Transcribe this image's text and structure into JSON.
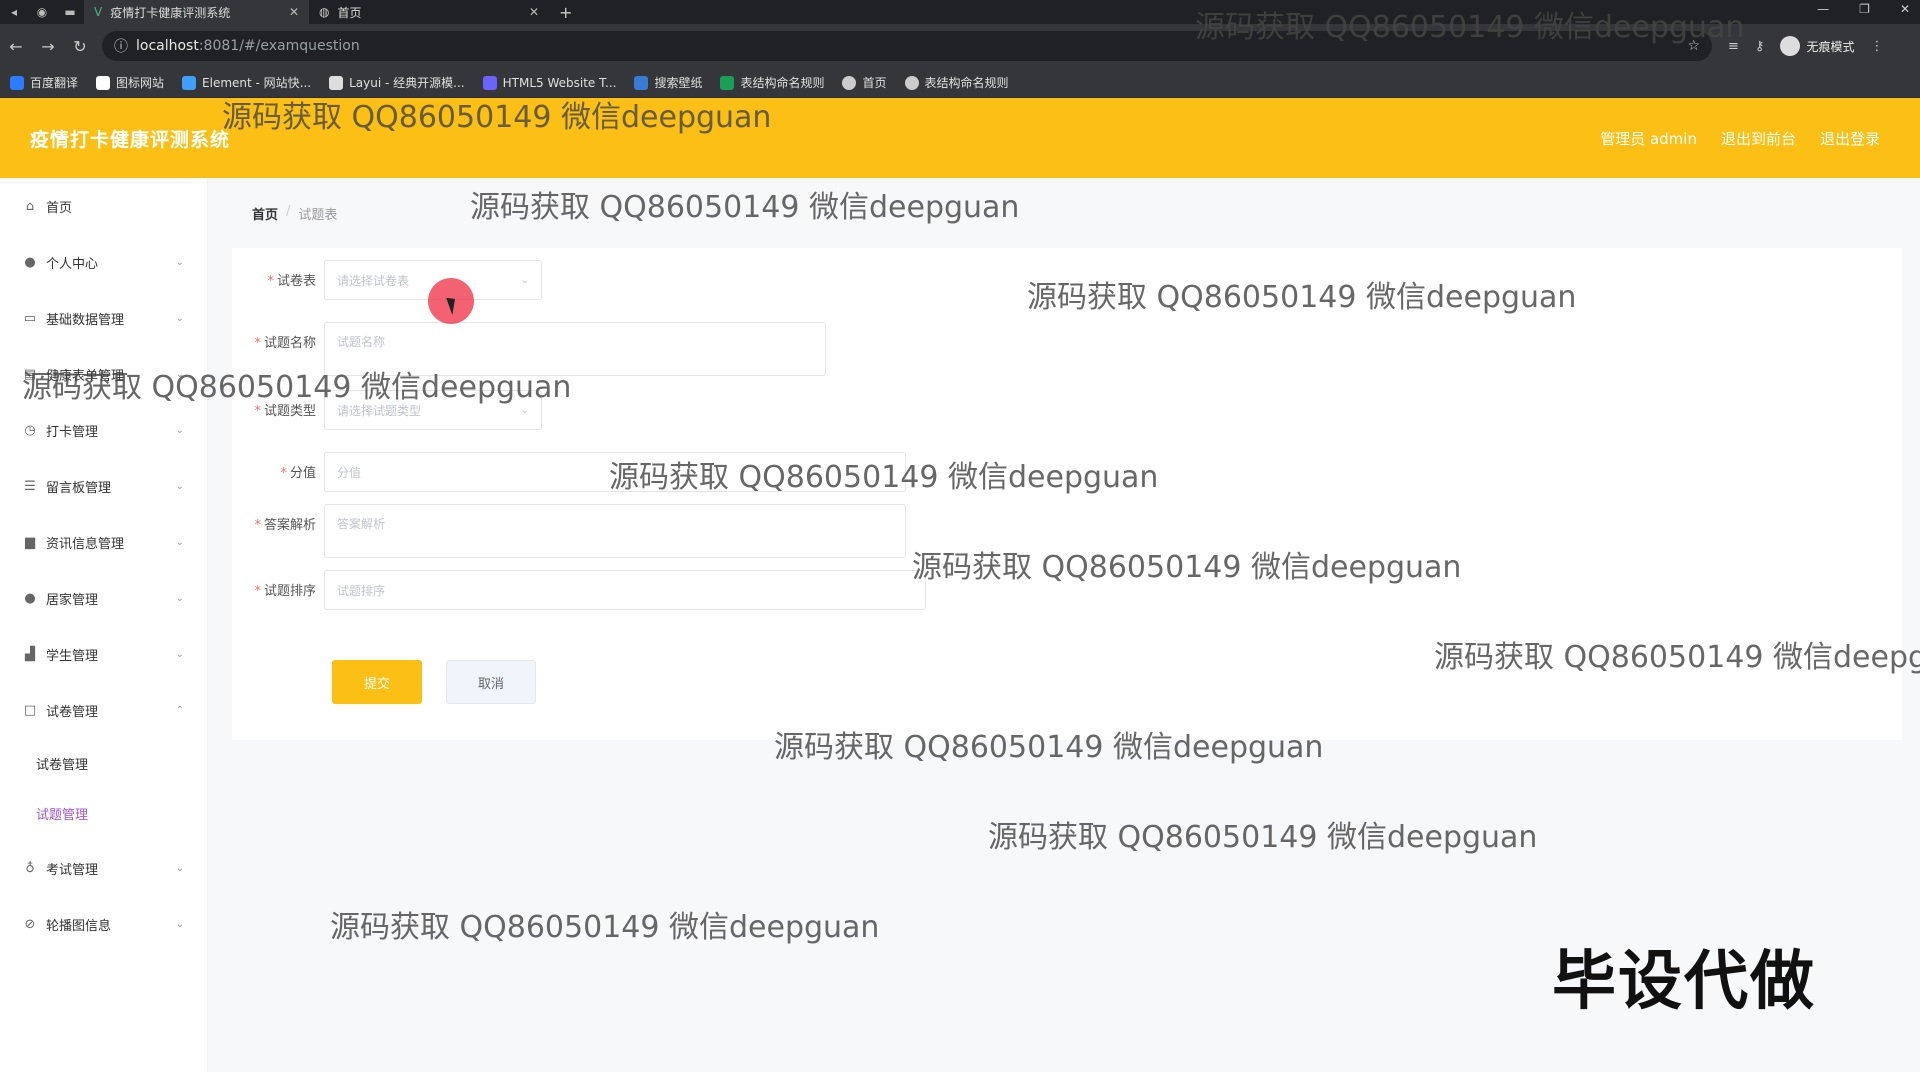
{
  "browser": {
    "tabs": [
      {
        "title": "疫情打卡健康评测系统",
        "active": true
      },
      {
        "title": "首页",
        "active": false
      }
    ],
    "url_host": "localhost",
    "url_path": ":8081/#/examquestion",
    "incognito_label": "无痕模式",
    "bookmarks": [
      {
        "label": "百度翻译",
        "color": "#2b7cff"
      },
      {
        "label": "图标网站",
        "color": "#ffffff"
      },
      {
        "label": "Element - 网站快...",
        "color": "#409eff"
      },
      {
        "label": "Layui - 经典开源模...",
        "color": "#dddddd"
      },
      {
        "label": "HTML5 Website T...",
        "color": "#6c63ff"
      },
      {
        "label": "搜索壁纸",
        "color": "#3a7bd5"
      },
      {
        "label": "表结构命名规则",
        "color": "#18a058"
      },
      {
        "label": "首页",
        "color": "#cccccc"
      },
      {
        "label": "表结构命名规则",
        "color": "#cccccc"
      }
    ]
  },
  "header": {
    "title": "疫情打卡健康评测系统",
    "admin_label": "管理员 admin",
    "to_front": "退出到前台",
    "logout": "退出登录"
  },
  "sidebar": {
    "items": [
      {
        "label": "首页",
        "icon": "home-icon"
      },
      {
        "label": "个人中心",
        "icon": "user-icon"
      },
      {
        "label": "基础数据管理",
        "icon": "data-icon"
      },
      {
        "label": "健康表单管理",
        "icon": "form-icon"
      },
      {
        "label": "打卡管理",
        "icon": "clock-icon"
      },
      {
        "label": "留言板管理",
        "icon": "message-icon"
      },
      {
        "label": "资讯信息管理",
        "icon": "news-icon"
      },
      {
        "label": "居家管理",
        "icon": "home-user-icon"
      },
      {
        "label": "学生管理",
        "icon": "student-icon"
      },
      {
        "label": "试卷管理",
        "icon": "paper-icon"
      },
      {
        "label": "考试管理",
        "icon": "mic-icon"
      },
      {
        "label": "轮播图信息",
        "icon": "image-icon"
      }
    ],
    "sub_items": [
      {
        "label": "试卷管理"
      },
      {
        "label": "试题管理"
      }
    ]
  },
  "breadcrumb": {
    "home": "首页",
    "current": "试题表"
  },
  "form": {
    "paper_label": "试卷表",
    "paper_placeholder": "请选择试卷表",
    "name_label": "试题名称",
    "name_placeholder": "试题名称",
    "type_label": "试题类型",
    "type_placeholder": "请选择试题类型",
    "score_label": "分值",
    "score_placeholder": "分值",
    "analysis_label": "答案解析",
    "analysis_placeholder": "答案解析",
    "order_label": "试题排序",
    "order_placeholder": "试题排序",
    "submit_label": "提交",
    "cancel_label": "取消"
  },
  "watermark": {
    "text": "源码获取 QQ86050149 微信deepguan",
    "clipped_text": "源码获取 QQ86050149 微信deepgu",
    "big_text": "毕设代做"
  }
}
